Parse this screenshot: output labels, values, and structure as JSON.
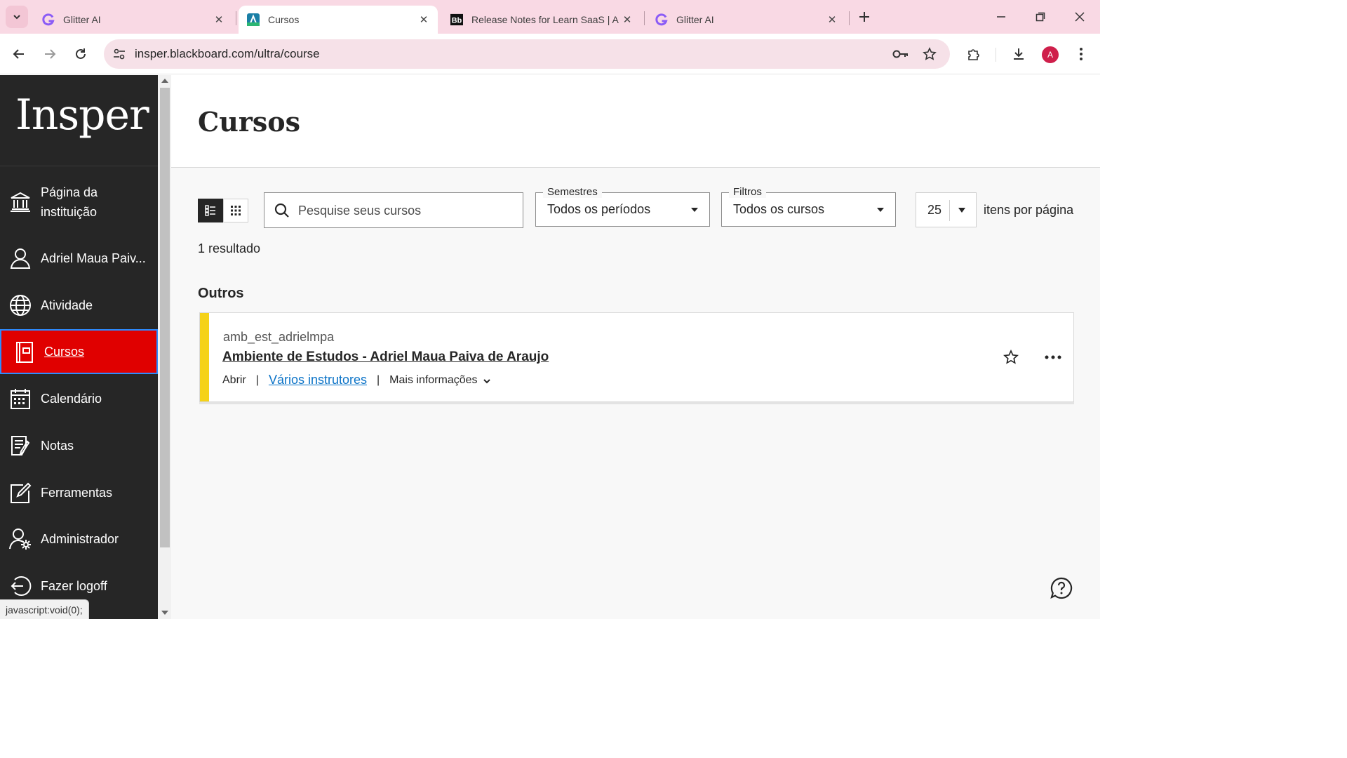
{
  "browser": {
    "tabs": [
      {
        "title": "Glitter AI",
        "favicon": "glitter-icon",
        "active": false
      },
      {
        "title": "Cursos",
        "favicon": "anthology-icon",
        "active": true
      },
      {
        "title": "Release Notes for Learn SaaS | A",
        "favicon": "blackboard-icon",
        "active": false
      },
      {
        "title": "Glitter AI",
        "favicon": "glitter-icon",
        "active": false
      }
    ],
    "url": "insper.blackboard.com/ultra/course",
    "profile_initial": "A",
    "status_text": "javascript:void(0);"
  },
  "sidebar": {
    "logo": "Insper",
    "items": [
      {
        "label": "Página da instituição",
        "icon": "institution-icon"
      },
      {
        "label": "Adriel Maua Paiv...",
        "icon": "user-icon"
      },
      {
        "label": "Atividade",
        "icon": "globe-icon"
      },
      {
        "label": "Cursos",
        "icon": "courses-icon",
        "active": true
      },
      {
        "label": "Calendário",
        "icon": "calendar-icon"
      },
      {
        "label": "Notas",
        "icon": "grades-icon"
      },
      {
        "label": "Ferramentas",
        "icon": "tools-icon"
      },
      {
        "label": "Administrador",
        "icon": "admin-icon"
      },
      {
        "label": "Fazer logoff",
        "icon": "logout-icon"
      }
    ]
  },
  "main": {
    "title": "Cursos",
    "search_placeholder": "Pesquise seus cursos",
    "semester_filter": {
      "legend": "Semestres",
      "value": "Todos os períodos"
    },
    "course_filter": {
      "legend": "Filtros",
      "value": "Todos os cursos"
    },
    "per_page": {
      "value": "25",
      "label": "itens por página"
    },
    "results_count": "1 resultado",
    "section_title": "Outros",
    "course": {
      "code": "amb_est_adrielmpa",
      "name": "Ambiente de Estudos - Adriel Maua Paiva de Araujo",
      "status": "Abrir",
      "instructors": "Vários instrutores",
      "more_info": "Mais informações",
      "stripe_color": "#f5d218"
    }
  },
  "colors": {
    "active_nav": "#e00000",
    "sidebar_bg": "#262626",
    "tabbar_bg": "#f9d9e4",
    "link": "#0b73c7"
  }
}
